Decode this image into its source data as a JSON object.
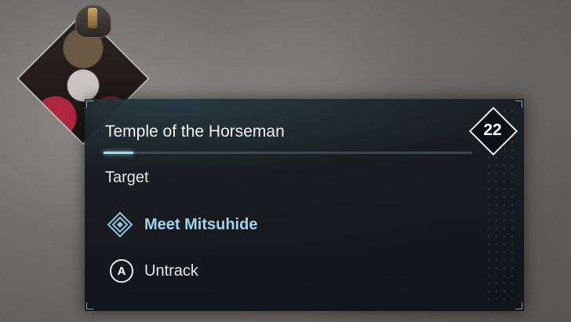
{
  "quest": {
    "title": "Temple of the Horseman",
    "level": "22",
    "progress": 0.08,
    "section_label": "Target",
    "objective": "Meet Mitsuhide"
  },
  "actions": {
    "untrack_key": "A",
    "untrack_label": "Untrack"
  },
  "colors": {
    "accent": "#9fd4ec",
    "progress": "#9fdcea",
    "panel_bg": "#141a1e",
    "text": "#f2f2f0"
  },
  "icons": {
    "objective": "quest-marker-icon",
    "level": "level-diamond-icon",
    "portrait": "quest-giver-portrait"
  }
}
